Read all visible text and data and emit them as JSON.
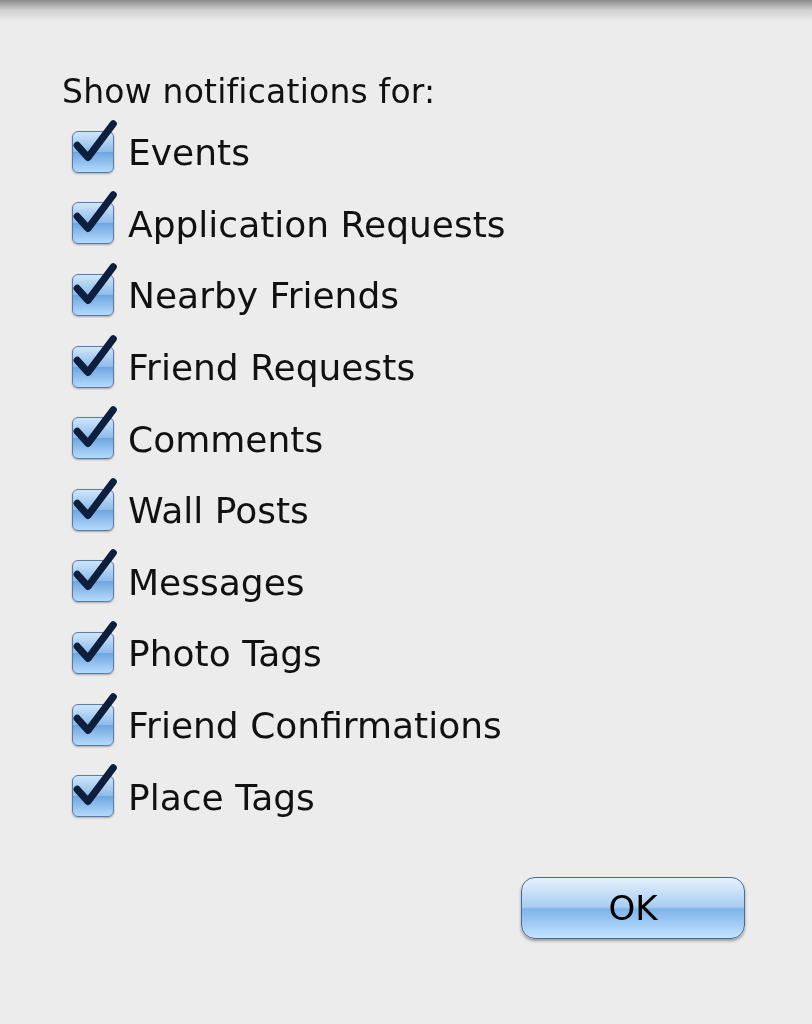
{
  "heading": "Show notifications for:",
  "options": [
    {
      "label": "Events",
      "checked": true
    },
    {
      "label": "Application Requests",
      "checked": true
    },
    {
      "label": "Nearby Friends",
      "checked": true
    },
    {
      "label": "Friend Requests",
      "checked": true
    },
    {
      "label": "Comments",
      "checked": true
    },
    {
      "label": "Wall Posts",
      "checked": true
    },
    {
      "label": "Messages",
      "checked": true
    },
    {
      "label": "Photo Tags",
      "checked": true
    },
    {
      "label": "Friend Confirmations",
      "checked": true
    },
    {
      "label": "Place Tags",
      "checked": true
    }
  ],
  "button": {
    "label": "OK"
  }
}
